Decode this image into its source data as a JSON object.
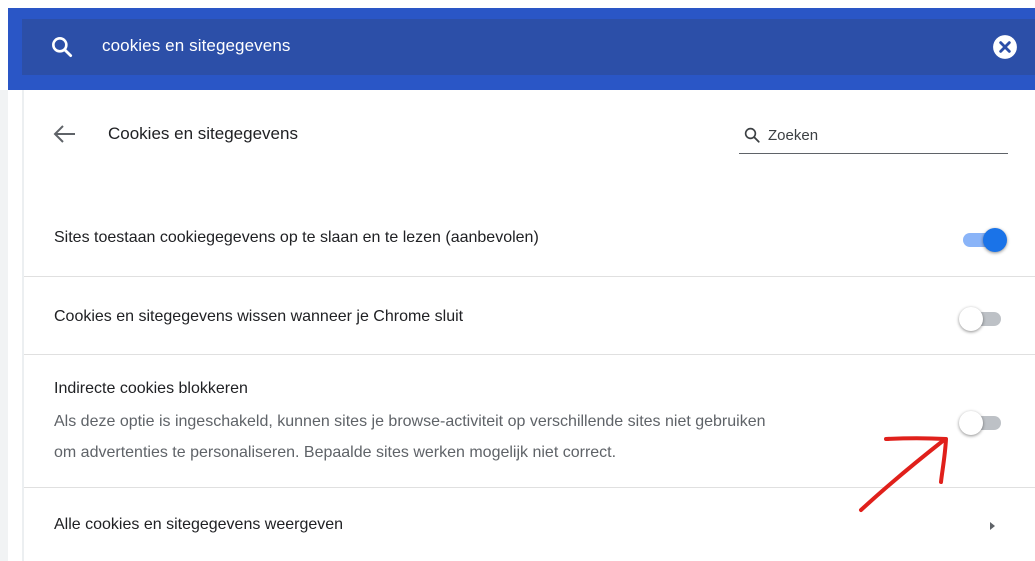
{
  "search_bar": {
    "query": "cookies en sitegegevens",
    "search_icon": "search-icon",
    "clear_icon": "close-circle-icon"
  },
  "header": {
    "back_icon": "arrow-left-icon",
    "title": "Cookies en sitegegevens",
    "search_placeholder": "Zoeken"
  },
  "settings": [
    {
      "label": "Sites toestaan cookiegegevens op te slaan en te lezen (aanbevolen)",
      "toggle": "on"
    },
    {
      "label": "Cookies en sitegegevens wissen wanneer je Chrome sluit",
      "toggle": "off"
    },
    {
      "label": "Indirecte cookies blokkeren",
      "description_line1": "Als deze optie is ingeschakeld, kunnen sites je browse-activiteit op verschillende sites niet gebruiken",
      "description_line2": "om advertenties te personaliseren. Bepaalde sites werken mogelijk niet correct.",
      "toggle": "off"
    },
    {
      "label": "Alle cookies en sitegegevens weergeven",
      "icon": "chevron-right-icon"
    }
  ],
  "colors": {
    "topbar": "#2a56c6",
    "toggle_on": "#1a73e8",
    "annotation": "#e0201b"
  }
}
